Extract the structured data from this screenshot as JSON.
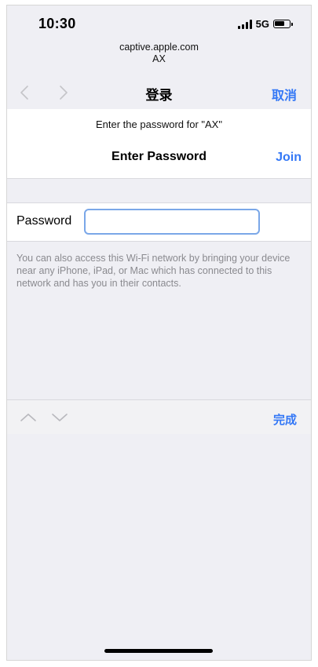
{
  "status_bar": {
    "time": "10:30",
    "network": "5G",
    "signal_icon": "signal-bars-icon",
    "battery_icon": "battery-icon"
  },
  "address": {
    "host": "captive.apple.com",
    "page_title": "AX"
  },
  "nav_bar": {
    "back_icon": "chevron-left-icon",
    "forward_icon": "chevron-right-icon",
    "title": "登录",
    "cancel_label": "取消"
  },
  "password_sheet": {
    "prompt": "Enter the password for \"AX\"",
    "title": "Enter Password",
    "join_label": "Join",
    "password_label": "Password",
    "password_value": "",
    "help_text": "You can also access this Wi-Fi network by bringing your device near any iPhone, iPad, or Mac which has connected to this network and has you in their contacts."
  },
  "keyboard_toolbar": {
    "up_icon": "chevron-up-icon",
    "down_icon": "chevron-down-icon",
    "done_label": "完成"
  },
  "colors": {
    "accent": "#3478f6",
    "background": "#efeff4",
    "secondary_text": "#8a8a8f"
  }
}
